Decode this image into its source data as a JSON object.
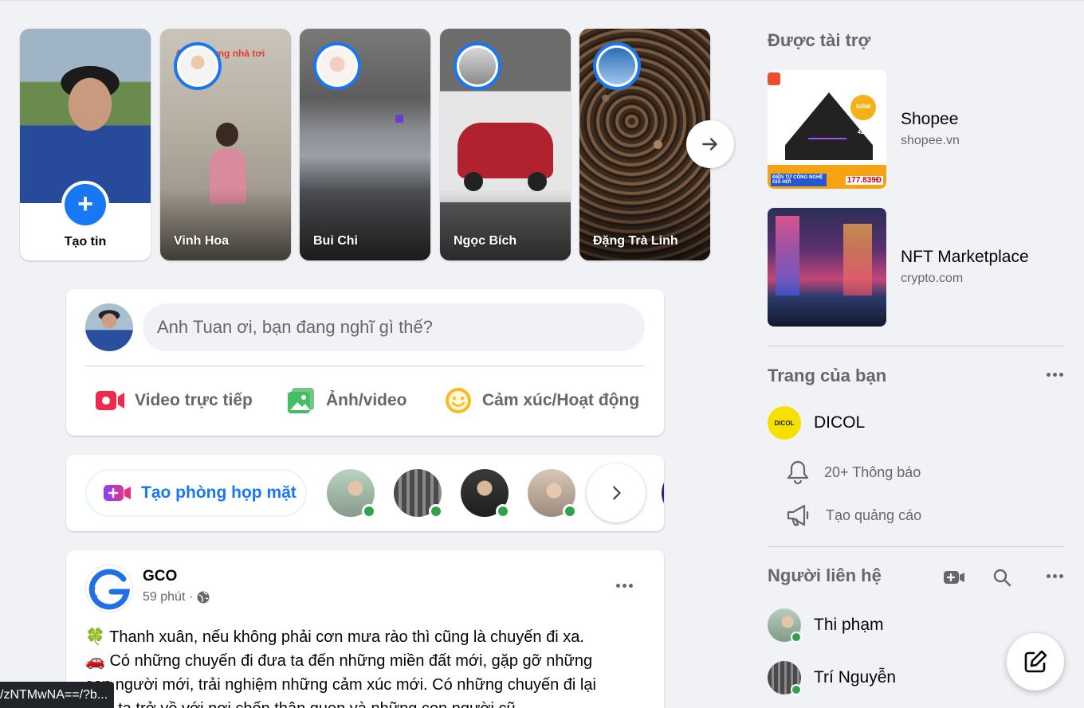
{
  "stories": {
    "create_label": "Tạo tin",
    "items": [
      {
        "name": "Vinh Hoa",
        "overlay_text": "Chúc mừng nhà tơi"
      },
      {
        "name": "Bui Chi"
      },
      {
        "name": "Ngọc Bích"
      },
      {
        "name": "Đặng Trà Linh"
      }
    ],
    "next_icon": "arrow-right-icon"
  },
  "composer": {
    "placeholder": "Anh Tuan ơi, bạn đang nghĩ gì thế?",
    "live_label": "Video trực tiếp",
    "photo_label": "Ảnh/video",
    "feeling_label": "Cảm xúc/Hoạt động"
  },
  "rooms": {
    "create_label": "Tạo phòng họp mặt"
  },
  "post": {
    "author": "GCO",
    "time": "59 phút ·",
    "lines": [
      "🍀 Thanh xuân, nếu không phải cơn mưa rào thì cũng là chuyến đi xa.",
      "🚗 Có những chuyến đi đưa ta đến những miền đất mới, gặp gỡ những",
      "con người mới, trải nghiệm những cảm xúc mới. Có những chuyến đi lại",
      "đưa ta trở về với nơi chốn thân quen và những con người cũ..."
    ]
  },
  "statusbar": {
    "url": "/zNTMwNA==/?b..."
  },
  "sidebar": {
    "sponsored_title": "Được tài trợ",
    "ads": [
      {
        "title": "Shopee",
        "domain": "shopee.vn",
        "badge": "GIẢM 42%",
        "price": "177.839Đ",
        "tag": "ĐIỆN TỬ CÔNG NGHỆ GIÁ HỜI"
      },
      {
        "title": "NFT Marketplace",
        "domain": "crypto.com"
      }
    ],
    "your_pages_title": "Trang của bạn",
    "page_name": "DICOL",
    "page_logo_text": "DICOL",
    "notifications_label": "20+ Thông báo",
    "create_ad_label": "Tạo quảng cáo",
    "contacts_title": "Người liên hệ",
    "contacts": [
      {
        "name": "Thi phạm"
      },
      {
        "name": "Trí Nguyễn"
      }
    ]
  },
  "colors": {
    "accent": "#1877f2",
    "online": "#31a24c",
    "background": "#f0f2f5",
    "secondary_text": "#65676b"
  }
}
